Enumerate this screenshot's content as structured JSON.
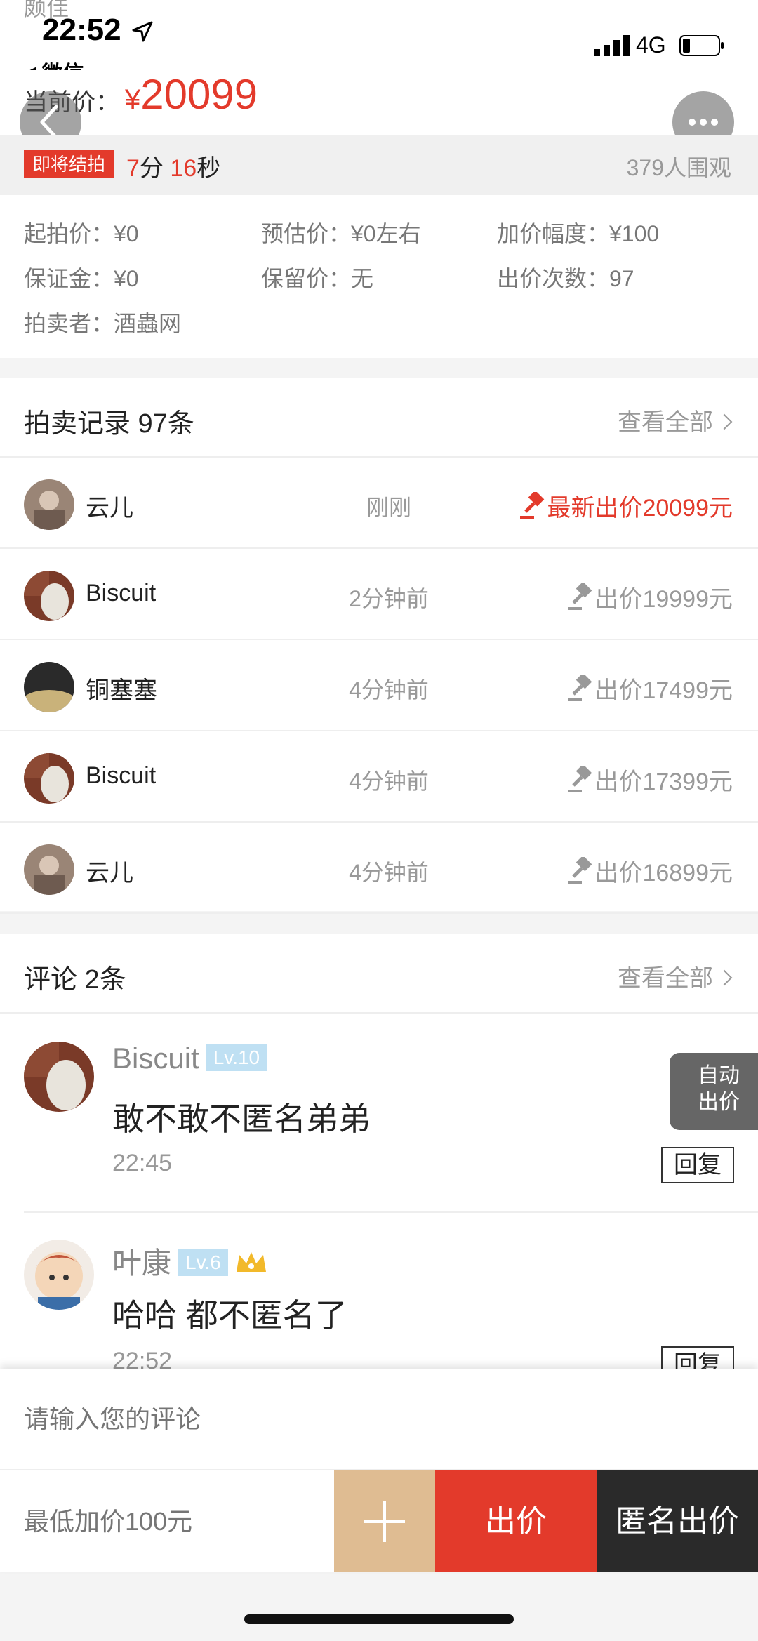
{
  "status_bar": {
    "clipped_text": "颇佳",
    "time": "22:52",
    "back_app": "◀ 微信",
    "network": "4G"
  },
  "price": {
    "label": "当前价：",
    "currency": "¥",
    "value": "20099"
  },
  "countdown": {
    "badge": "即将结拍",
    "minutes": "7",
    "min_unit": "分 ",
    "seconds": "16",
    "sec_unit": "秒",
    "watchers": "379人围观"
  },
  "info": {
    "start_price": "起拍价：¥0",
    "estimate": "预估价：¥0左右",
    "increment": "加价幅度：¥100",
    "deposit": "保证金：¥0",
    "reserve": "保留价：无",
    "bid_count": "出价次数：97",
    "seller": "拍卖者：酒蟲网"
  },
  "records": {
    "title": "拍卖记录 97条",
    "view_all": "查看全部",
    "rows": [
      {
        "name": "云儿",
        "time": "刚刚",
        "bid": "最新出价20099元"
      },
      {
        "name": "Biscuit",
        "time": "2分钟前",
        "bid": "出价19999元"
      },
      {
        "name": "铜塞塞",
        "time": "4分钟前",
        "bid": "出价17499元"
      },
      {
        "name": "Biscuit",
        "time": "4分钟前",
        "bid": "出价17399元"
      },
      {
        "name": "云儿",
        "time": "4分钟前",
        "bid": "出价16899元"
      }
    ]
  },
  "comments": {
    "title": "评论 2条",
    "view_all": "查看全部",
    "items": [
      {
        "name": "Biscuit",
        "level": "Lv.10",
        "text": "敢不敢不匿名弟弟",
        "time": "22:45",
        "reply": "回复"
      },
      {
        "name": "叶康",
        "level": "Lv.6",
        "text": "哈哈 都不匿名了",
        "time": "22:52",
        "reply": "回复"
      }
    ],
    "auto_bid": [
      "自动",
      "出价"
    ]
  },
  "bottom": {
    "comment_placeholder": "请输入您的评论",
    "bid_placeholder": "最低加价100元",
    "bid_label": "出价",
    "anon_label": "匿名出价"
  },
  "colors": {
    "accent_red": "#e33a2b",
    "plus_button": "#dfbc92",
    "anon_button": "#2a2a2a"
  }
}
